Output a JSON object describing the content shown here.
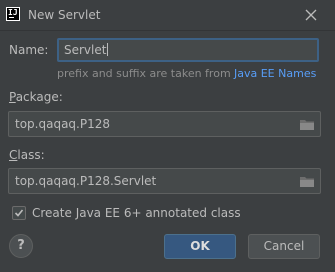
{
  "dialog": {
    "title": "New Servlet",
    "app_icon_text": "IJ"
  },
  "name": {
    "label": "Name:",
    "value": "Servlet",
    "hint": "prefix and suffix are taken from",
    "hint_link": "Java EE Names"
  },
  "package": {
    "label_mnemonic": "P",
    "label_rest": "ackage:",
    "value": "top.qaqaq.P128"
  },
  "class": {
    "label_mnemonic": "C",
    "label_rest": "lass:",
    "value": "top.qaqaq.P128.Servlet"
  },
  "annotated": {
    "label": "Create Java EE 6+ annotated class",
    "checked": true
  },
  "buttons": {
    "help": "?",
    "ok": "OK",
    "cancel": "Cancel"
  },
  "colors": {
    "background": "#3c3f41",
    "accent": "#365880",
    "link": "#589df6",
    "focus_border": "#3d6185"
  }
}
